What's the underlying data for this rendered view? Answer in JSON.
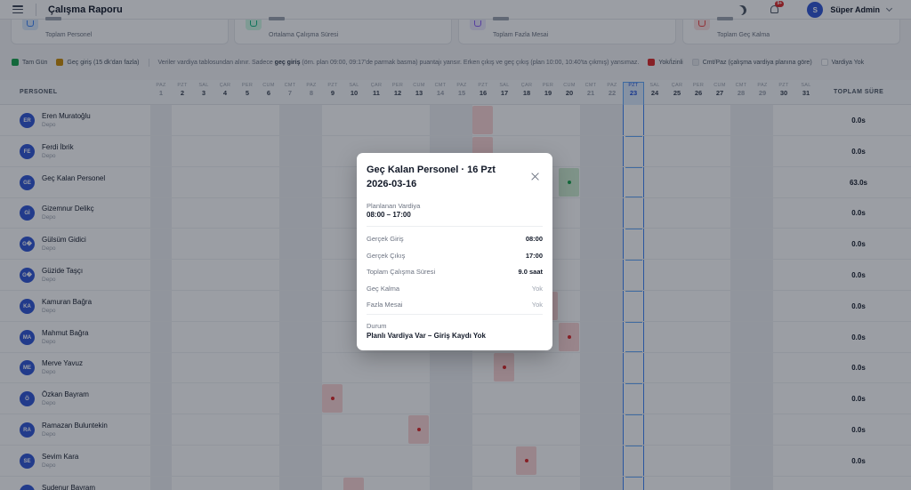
{
  "topbar": {
    "title": "Çalışma Raporu",
    "notif_badge": "9+",
    "user_initial": "S",
    "user_name": "Süper Admin"
  },
  "stats": [
    {
      "label": "Toplam Personel",
      "color": "#3b82f6",
      "bg": "#dbeafe"
    },
    {
      "label": "Ortalama Çalışma Süresi",
      "color": "#10b981",
      "bg": "#d1fae5"
    },
    {
      "label": "Toplam Fazla Mesai",
      "color": "#8b5cf6",
      "bg": "#ede9fe"
    },
    {
      "label": "Toplam Geç Kalma",
      "color": "#ef4444",
      "bg": "#fee2e2"
    }
  ],
  "legend": {
    "full_day": "Tam Gün",
    "late": "Geç giriş (15 dk'dan fazla)",
    "note_pre": "Veriler vardiya tablosundan alınır. Sadece",
    "note_bold": "geç giriş",
    "note_post": "(örn. plan 09:00, 09:17'de parmak basma) puantajı yansır. Erken çıkış ve geç çıkış (plan 10:00, 10:40'ta çıkmış) yansımaz.",
    "absent": "Yok/İzinli",
    "weekend": "Cmt/Paz (çalışma vardiya planına göre)",
    "no_shift": "Vardiya Yok",
    "colors": {
      "full_day": "#16a34a",
      "late": "#ca8a04",
      "absent": "#dc2626",
      "weekend": "#e5e7eb",
      "no_shift": "#ffffff"
    }
  },
  "table": {
    "name_header": "PERSONEL",
    "total_header": "TOPLAM SÜRE",
    "days": [
      {
        "n": "PAZ",
        "d": "1"
      },
      {
        "n": "PZT",
        "d": "2"
      },
      {
        "n": "SAL",
        "d": "3"
      },
      {
        "n": "ÇAR",
        "d": "4"
      },
      {
        "n": "PER",
        "d": "5"
      },
      {
        "n": "CUM",
        "d": "6"
      },
      {
        "n": "CMT",
        "d": "7"
      },
      {
        "n": "PAZ",
        "d": "8"
      },
      {
        "n": "PZT",
        "d": "9"
      },
      {
        "n": "SAL",
        "d": "10"
      },
      {
        "n": "ÇAR",
        "d": "11"
      },
      {
        "n": "PER",
        "d": "12"
      },
      {
        "n": "CUM",
        "d": "13"
      },
      {
        "n": "CMT",
        "d": "14"
      },
      {
        "n": "PAZ",
        "d": "15"
      },
      {
        "n": "PZT",
        "d": "16"
      },
      {
        "n": "SAL",
        "d": "17"
      },
      {
        "n": "ÇAR",
        "d": "18"
      },
      {
        "n": "PER",
        "d": "19"
      },
      {
        "n": "CUM",
        "d": "20"
      },
      {
        "n": "CMT",
        "d": "21"
      },
      {
        "n": "PAZ",
        "d": "22"
      },
      {
        "n": "PZT",
        "d": "23"
      },
      {
        "n": "SAL",
        "d": "24"
      },
      {
        "n": "ÇAR",
        "d": "25"
      },
      {
        "n": "PER",
        "d": "26"
      },
      {
        "n": "CUM",
        "d": "27"
      },
      {
        "n": "CMT",
        "d": "28"
      },
      {
        "n": "PAZ",
        "d": "29"
      },
      {
        "n": "PZT",
        "d": "30"
      },
      {
        "n": "SAL",
        "d": "31"
      }
    ],
    "weekend_days": [
      1,
      7,
      8,
      14,
      15,
      21,
      22,
      28,
      29
    ],
    "today": 23,
    "rows": [
      {
        "ini": "ER",
        "name": "Eren Muratoğlu",
        "dept": "Depo",
        "total": "0.0s",
        "marks": [
          {
            "day": 16,
            "type": "red",
            "dot": false
          }
        ]
      },
      {
        "ini": "FE",
        "name": "Ferdi İbrik",
        "dept": "Depo",
        "total": "0.0s",
        "marks": [
          {
            "day": 16,
            "type": "red",
            "dot": false
          }
        ]
      },
      {
        "ini": "GE",
        "name": "Geç Kalan Personel",
        "dept": "",
        "total": "63.0s",
        "marks": [
          {
            "day": 20,
            "type": "green",
            "dot": true
          }
        ]
      },
      {
        "ini": "Gİ",
        "name": "Gizemnur Delikç",
        "dept": "Depo",
        "total": "0.0s",
        "marks": []
      },
      {
        "ini": "G�",
        "name": "Gülsüm Gidici",
        "dept": "Depo",
        "total": "0.0s",
        "marks": []
      },
      {
        "ini": "G�",
        "name": "Güzide Taşçı",
        "dept": "Depo",
        "total": "0.0s",
        "marks": []
      },
      {
        "ini": "KA",
        "name": "Kamuran Bağra",
        "dept": "Depo",
        "total": "0.0s",
        "marks": [
          {
            "day": 19,
            "type": "red",
            "dot": false
          }
        ]
      },
      {
        "ini": "MA",
        "name": "Mahmut Bağra",
        "dept": "Depo",
        "total": "0.0s",
        "marks": [
          {
            "day": 20,
            "type": "red",
            "dot": true
          }
        ]
      },
      {
        "ini": "ME",
        "name": "Merve Yavuz",
        "dept": "Depo",
        "total": "0.0s",
        "marks": [
          {
            "day": 17,
            "type": "red",
            "dot": true
          }
        ]
      },
      {
        "ini": "Ö",
        "name": "Özkan Bayram",
        "dept": "Depo",
        "total": "0.0s",
        "marks": [
          {
            "day": 9,
            "type": "red",
            "dot": true
          }
        ]
      },
      {
        "ini": "RA",
        "name": "Ramazan Buluntekin",
        "dept": "Depo",
        "total": "0.0s",
        "marks": [
          {
            "day": 13,
            "type": "red",
            "dot": true
          }
        ]
      },
      {
        "ini": "SE",
        "name": "Sevim Kara",
        "dept": "Depo",
        "total": "0.0s",
        "marks": [
          {
            "day": 18,
            "type": "red",
            "dot": true
          }
        ]
      },
      {
        "ini": "SU",
        "name": "Sudenur Bayram",
        "dept": "",
        "total": "",
        "marks": [
          {
            "day": 10,
            "type": "red",
            "dot": false
          }
        ]
      }
    ]
  },
  "modal": {
    "title": "Geç Kalan Personel · 16 Pzt 2026-03-16",
    "planned_label": "Planlanan Vardiya",
    "planned_value": "08:00 – 17:00",
    "rows": [
      {
        "k": "Gerçek Giriş",
        "v": "08:00",
        "muted": false
      },
      {
        "k": "Gerçek Çıkış",
        "v": "17:00",
        "muted": false
      },
      {
        "k": "Toplam Çalışma Süresi",
        "v": "9.0 saat",
        "muted": false
      },
      {
        "k": "Geç Kalma",
        "v": "Yok",
        "muted": true
      },
      {
        "k": "Fazla Mesai",
        "v": "Yok",
        "muted": true
      }
    ],
    "status_label": "Durum",
    "status_value": "Planlı Vardiya Var – Giriş Kaydı Yok"
  }
}
